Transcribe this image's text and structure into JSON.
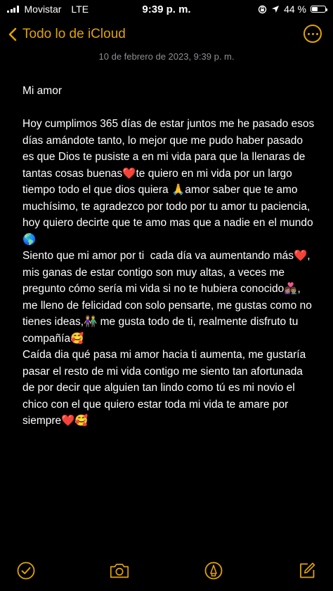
{
  "status_bar": {
    "carrier": "Movistar",
    "network": "LTE",
    "time": "9:39 p. m.",
    "battery_percent": "44 %",
    "battery_level": 0.44
  },
  "nav": {
    "back_label": "Todo lo de iCloud",
    "more_icon": "ellipsis-circle-icon"
  },
  "note": {
    "date": "10 de febrero de 2023, 9:39 p. m.",
    "title": "Mi amor",
    "paragraphs": [
      "Hoy cumplimos 365 días de estar juntos me he pasado esos días amándote tanto, lo mejor que me pudo haber pasado es que Dios te pusiste a en mi vida para que la llenaras de tantas cosas buenas❤️te quiero en mi vida por un largo tiempo todo el que dios quiera 🙏amor saber que te amo muchísimo, te agradezco por todo por tu amor tu paciencia, hoy quiero decirte que te amo mas que a nadie en el mundo 🌎",
      "Siento que mi amor por ti  cada día va aumentando más❤️, mis ganas de estar contigo son muy altas, a veces me pregunto cómo sería mi vida si no te hubiera conocido👩🏽‍❤️‍👨🏽, me lleno de felicidad con solo pensarte, me gustas como no tienes ideas,👫 me gusta todo de ti, realmente disfruto tu compañía🥰",
      "Caída dia qué pasa mi amor hacia ti aumenta, me gustaría pasar el resto de mi vida contigo me siento tan afortunada de por decir que alguien tan lindo como tú es mi novio el chico con el que quiero estar toda mi vida te amare por siempre❤️🥰"
    ]
  },
  "toolbar": {
    "items": [
      "checklist-icon",
      "camera-icon",
      "markup-pen-icon",
      "compose-icon"
    ]
  },
  "colors": {
    "accent": "#e0a300",
    "background": "#000000",
    "text": "#ffffff",
    "secondary_text": "#8e8e93"
  }
}
